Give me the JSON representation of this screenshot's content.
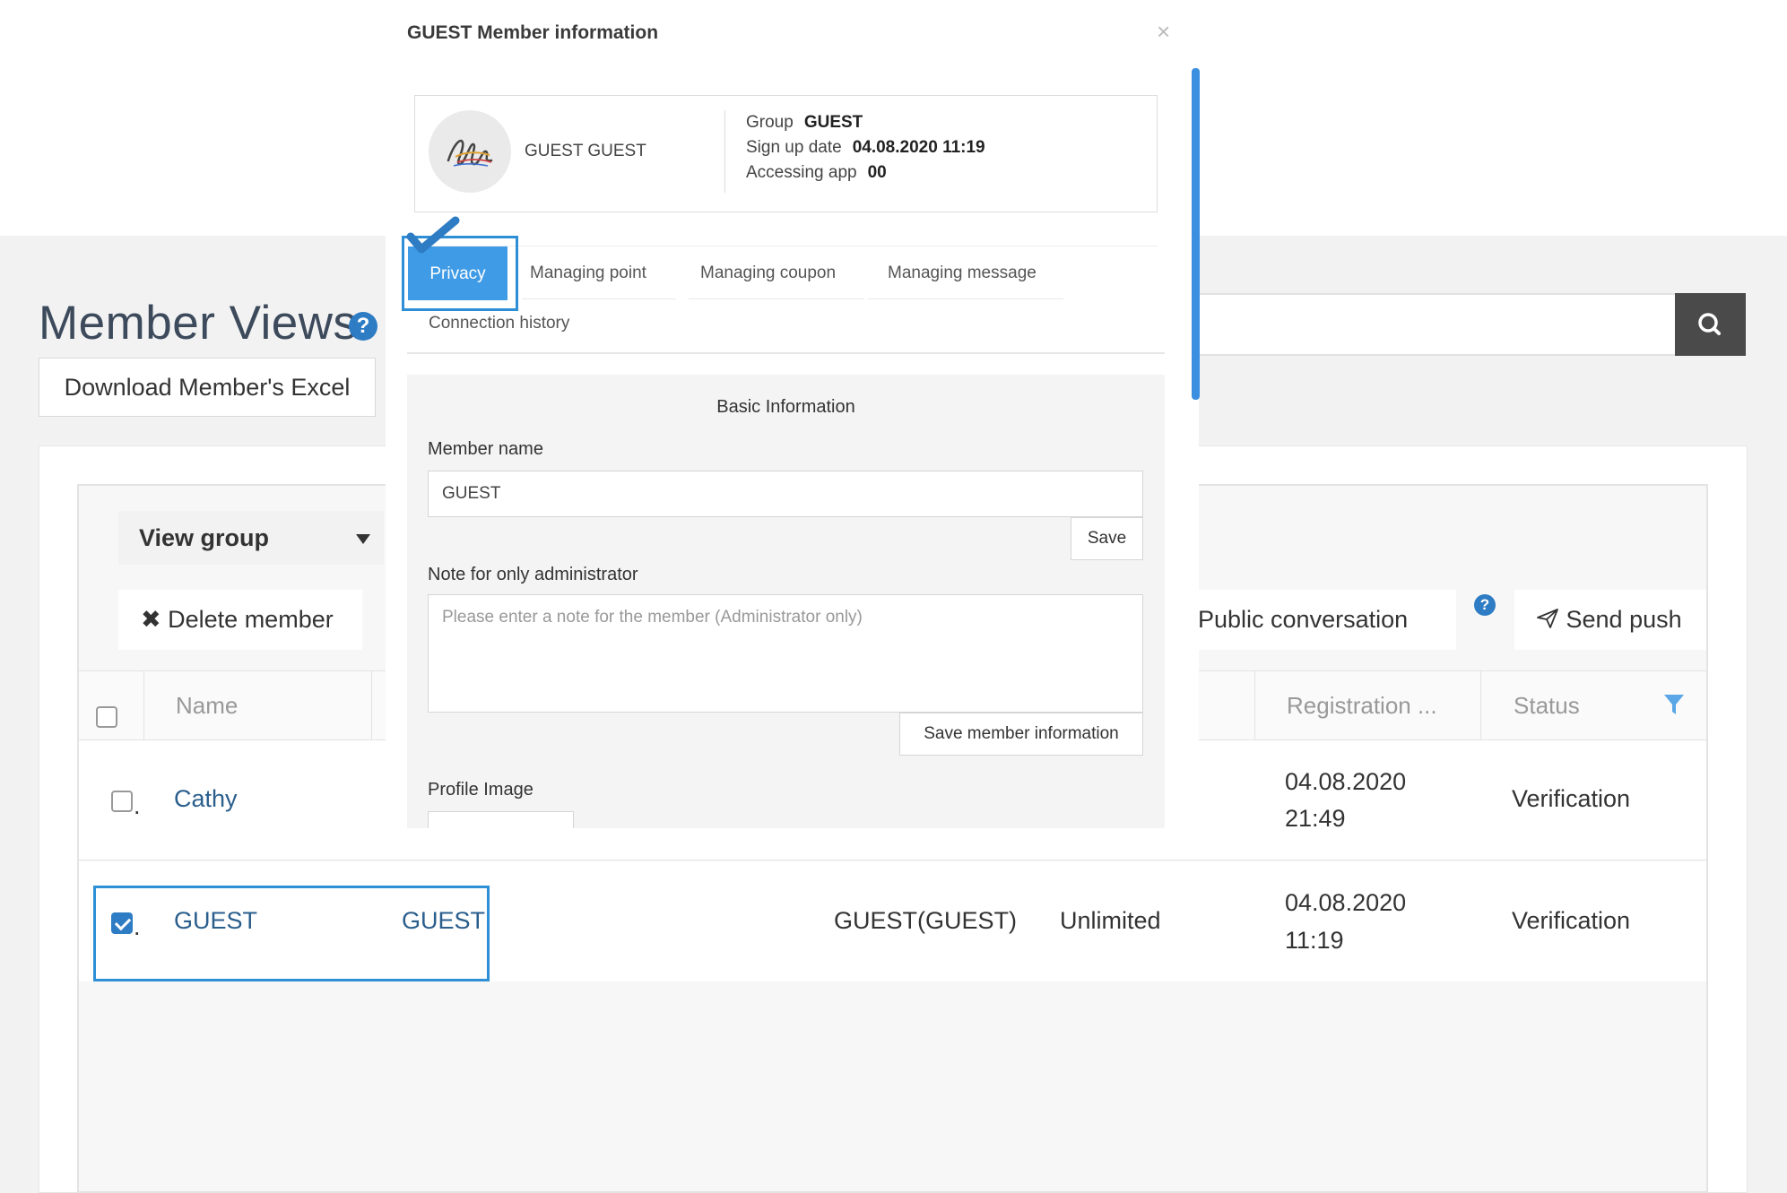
{
  "page": {
    "title": "Member Views",
    "download_excel": "Download Member's Excel"
  },
  "toolbar": {
    "view_group": "View group",
    "delete_member": "Delete member",
    "public_conversation": "Public conversation",
    "send_push": "Send push"
  },
  "table": {
    "headers": {
      "name": "Name",
      "registration": "Registration ...",
      "status": "Status"
    },
    "rows": [
      {
        "name": "Cathy",
        "registration_date": "04.08.2020",
        "registration_time": "21:49",
        "status": "Verification",
        "checked": false
      },
      {
        "name": "GUEST",
        "name2": "GUEST",
        "group": "GUEST(GUEST)",
        "period": "Unlimited",
        "registration_date": "04.08.2020",
        "registration_time": "11:19",
        "status": "Verification",
        "checked": true
      }
    ]
  },
  "modal": {
    "title": "GUEST Member information",
    "close": "×",
    "profile": {
      "name": "GUEST GUEST",
      "group_label": "Group",
      "group_value": "GUEST",
      "signup_label": "Sign up date",
      "signup_value": "04.08.2020 11:19",
      "app_label": "Accessing app",
      "app_value": "00"
    },
    "tabs": [
      "Privacy",
      "Managing point",
      "Managing coupon",
      "Managing message",
      "Connection history"
    ],
    "form": {
      "heading": "Basic Information",
      "member_name_label": "Member name",
      "member_name_value": "GUEST",
      "save": "Save",
      "note_label": "Note for only administrator",
      "note_placeholder": "Please enter a note for the member (Administrator only)",
      "save_member_info": "Save member information",
      "profile_image_label": "Profile Image"
    }
  },
  "colors": {
    "accent": "#3f9be6",
    "highlight_outline": "#2e8fd6",
    "link": "#2a5e8c",
    "title": "#3c4a5b",
    "search_button": "#4a4a4a"
  },
  "icons": [
    "help-icon",
    "search-icon",
    "caret-down-icon",
    "close-x-icon",
    "send-icon",
    "filter-icon",
    "check-mark-icon",
    "avatar-signature-icon"
  ]
}
